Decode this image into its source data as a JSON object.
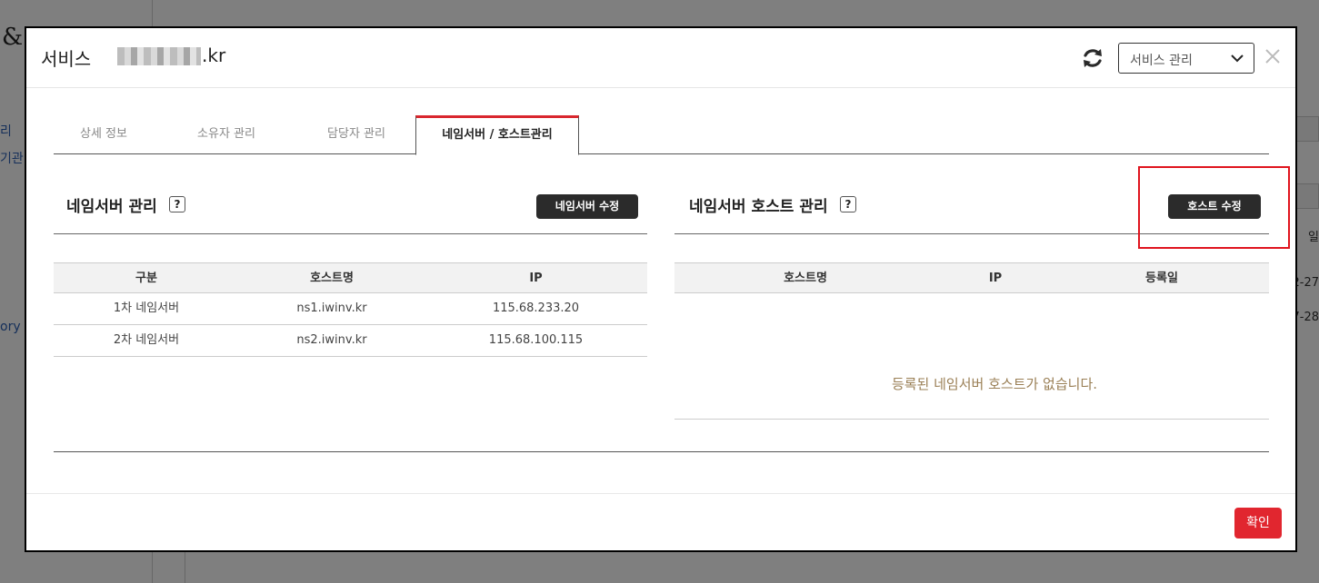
{
  "background": {
    "amp_char": "&",
    "left_texts": [
      "리",
      "기관",
      "ory"
    ],
    "right_texts": [
      "일",
      "2-27",
      "7-28"
    ]
  },
  "modal": {
    "title": "서비스",
    "domain_suffix": ".kr",
    "service_select": {
      "selected": "서비스 관리"
    },
    "icons": {
      "refresh": "refresh-icon",
      "close": "close-icon",
      "dropdown": "chevron-down-icon"
    }
  },
  "tabs": [
    {
      "label": "상세 정보",
      "active": false
    },
    {
      "label": "소유자 관리",
      "active": false
    },
    {
      "label": "담당자 관리",
      "active": false
    },
    {
      "label": "네임서버 / 호스트관리",
      "active": true
    }
  ],
  "nameserver_panel": {
    "title": "네임서버 관리",
    "help": "?",
    "edit_button": "네임서버 수정",
    "columns": [
      "구분",
      "호스트명",
      "IP"
    ],
    "rows": [
      {
        "type": "1차 네임서버",
        "host": "ns1.iwinv.kr",
        "ip": "115.68.233.20"
      },
      {
        "type": "2차 네임서버",
        "host": "ns2.iwinv.kr",
        "ip": "115.68.100.115"
      }
    ]
  },
  "host_panel": {
    "title": "네임서버 호스트 관리",
    "help": "?",
    "edit_button": "호스트 수정",
    "columns": [
      "호스트명",
      "IP",
      "등록일"
    ],
    "empty_message": "등록된 네임서버 호스트가 없습니다."
  },
  "footer": {
    "confirm_label": "확인"
  },
  "colors": {
    "accent_red": "#e1262f",
    "dark_button": "#2b2b2b",
    "empty_text": "#9a7f55"
  }
}
